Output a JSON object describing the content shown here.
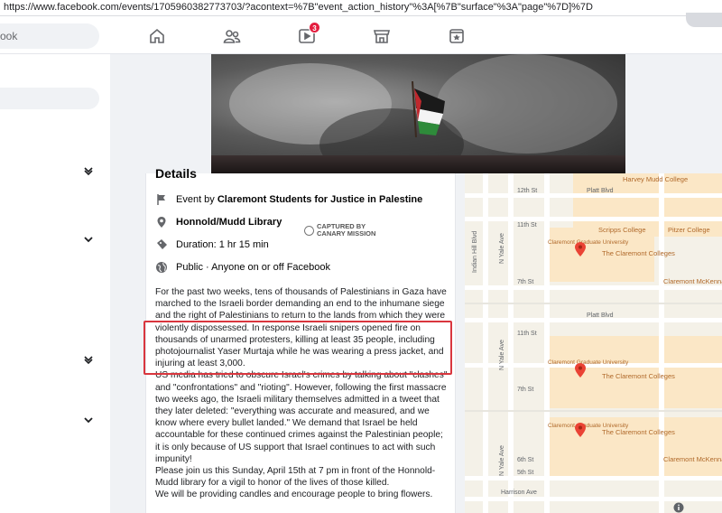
{
  "browser": {
    "url": "https://www.facebook.com/events/1705960382773703/?acontext=%7B\"event_action_history\"%3A[%7B\"surface\"%3A\"page\"%7D]%7D"
  },
  "topnav": {
    "search_placeholder": "ook",
    "watch_badge": "3"
  },
  "details": {
    "title": "Details",
    "organizer_prefix": "Event by ",
    "organizer": "Claremont Students for Justice in Palestine",
    "location": "Honnold/Mudd Library",
    "duration": "Duration: 1 hr 15 min",
    "privacy": "Public · Anyone on or off Facebook",
    "watermark_line1": "CAPTURED BY",
    "watermark_line2": "CANARY MISSION",
    "description": [
      "For the past two weeks, tens of thousands of Palestinians in Gaza have marched to the Israeli border demanding an end to the inhumane siege and the right of Palestinians to return to the lands from which they were violently dispossessed. In response Israeli snipers opened fire on thousands of unarmed protesters, killing at least 35 people, including photojournalist Yaser Murtaja while he was wearing a press jacket, and injuring at least 3,000.",
      "US media has tried to obscure Israel's crimes by talking about \"clashes\" and \"confrontations\" and \"rioting\". However, following the first massacre two weeks ago, the Israeli military themselves admitted in a tweet that they later deleted: \"everything was accurate and measured, and we know where every bullet landed.\" We demand that Israel be held accountable for these continued crimes against the Palestinian people; it is only because of US support that Israel continues to act with such impunity!",
      "Please join us this Sunday, April 15th at 7 pm in front of the Honnold-Mudd library for a vigil to honor of the lives of those killed.",
      "We will be providing candles and encourage people to bring flowers."
    ]
  },
  "map": {
    "streets": [
      "12th St",
      "Platt Blvd",
      "11th St",
      "7th St",
      "6th St",
      "5th St",
      "Harrison Ave",
      "Indian Hill Blvd",
      "N Yale Ave"
    ],
    "places": [
      "Harvey Mudd College",
      "Scripps College",
      "Pitzer College",
      "Claremont Graduate University",
      "The Claremont Colleges",
      "Claremont McKenna"
    ],
    "colors": {
      "pin": "#ea4335",
      "campus": "#fbe7c6",
      "label": "#b0692a"
    }
  }
}
